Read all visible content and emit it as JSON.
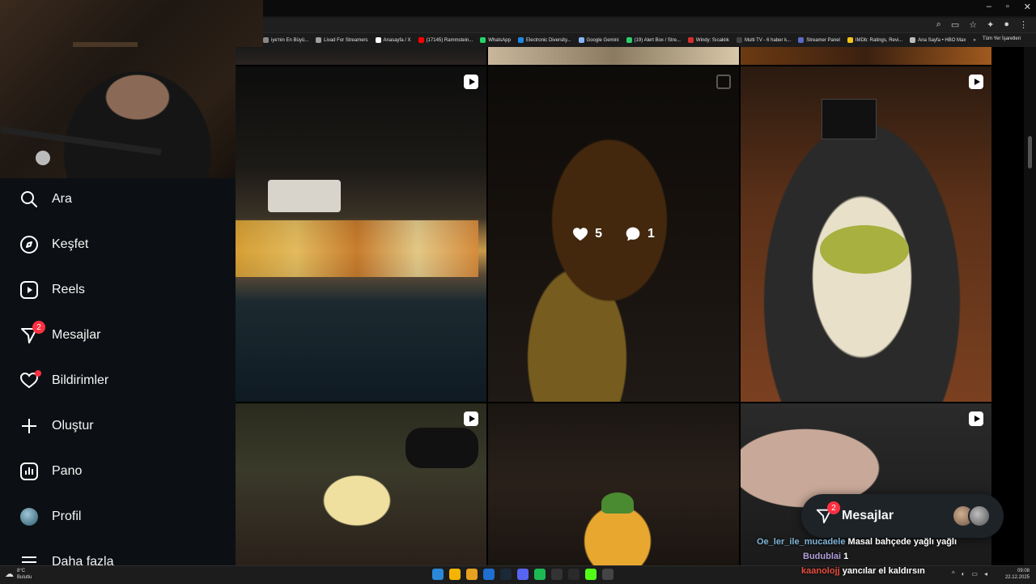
{
  "browser": {
    "bookmarks": [
      {
        "label": "iye'nin En Büyü...",
        "color": "#888888"
      },
      {
        "label": "Livad For Streamers",
        "color": "#9aa0a6"
      },
      {
        "label": "Anasayfa / X",
        "color": "#ffffff"
      },
      {
        "label": "(17145) Rammstein...",
        "color": "#ff0000"
      },
      {
        "label": "WhatsApp",
        "color": "#25d366"
      },
      {
        "label": "Electronic Diversity...",
        "color": "#1e88e5"
      },
      {
        "label": "Google Gemini",
        "color": "#8ab4f8"
      },
      {
        "label": "(19) Alert Box / Stre...",
        "color": "#2ecc71"
      },
      {
        "label": "Windy: Sıcaklık",
        "color": "#d32f2f"
      },
      {
        "label": "Multi TV - 6 haber k...",
        "color": "#444444"
      },
      {
        "label": "Streamer Panel",
        "color": "#5c6bc0"
      },
      {
        "label": "IMDb: Ratings, Revi...",
        "color": "#f5c518"
      },
      {
        "label": "Ana Sayfa • HBO Max",
        "color": "#bbbbbb"
      }
    ],
    "bookmarks_more": "»",
    "all_bookmarks": "Tüm Yer İşaretleri"
  },
  "sidebar": {
    "items": [
      {
        "label": "Ara",
        "icon": "search-icon"
      },
      {
        "label": "Keşfet",
        "icon": "compass-icon"
      },
      {
        "label": "Reels",
        "icon": "reels-icon"
      },
      {
        "label": "Mesajlar",
        "icon": "messenger-icon",
        "badge": "2"
      },
      {
        "label": "Bildirimler",
        "icon": "heart-icon"
      },
      {
        "label": "Oluştur",
        "icon": "plus-icon"
      },
      {
        "label": "Pano",
        "icon": "dashboard-icon"
      },
      {
        "label": "Profil",
        "icon": "avatar"
      },
      {
        "label": "Daha fazla",
        "icon": "menu-icon"
      }
    ]
  },
  "grid": {
    "hovered_post": {
      "likes": "5",
      "comments": "1"
    }
  },
  "messages_pill": {
    "label": "Mesajlar",
    "badge": "2"
  },
  "chat": [
    {
      "user": "Oe_ler_ile_mucadele",
      "user_color": "#7fb3d5",
      "message": "Masal bahçede yağlı yağlı"
    },
    {
      "user": "Budublai",
      "user_color": "#b39ddb",
      "message": "1"
    },
    {
      "user": "kaanolojj",
      "user_color": "#e74c3c",
      "message": "yancılar el kaldırsın"
    }
  ],
  "taskbar": {
    "weather_temp": "8°C",
    "weather_desc": "Bulutlu",
    "time": "09:08",
    "date": "22.12.2025"
  }
}
